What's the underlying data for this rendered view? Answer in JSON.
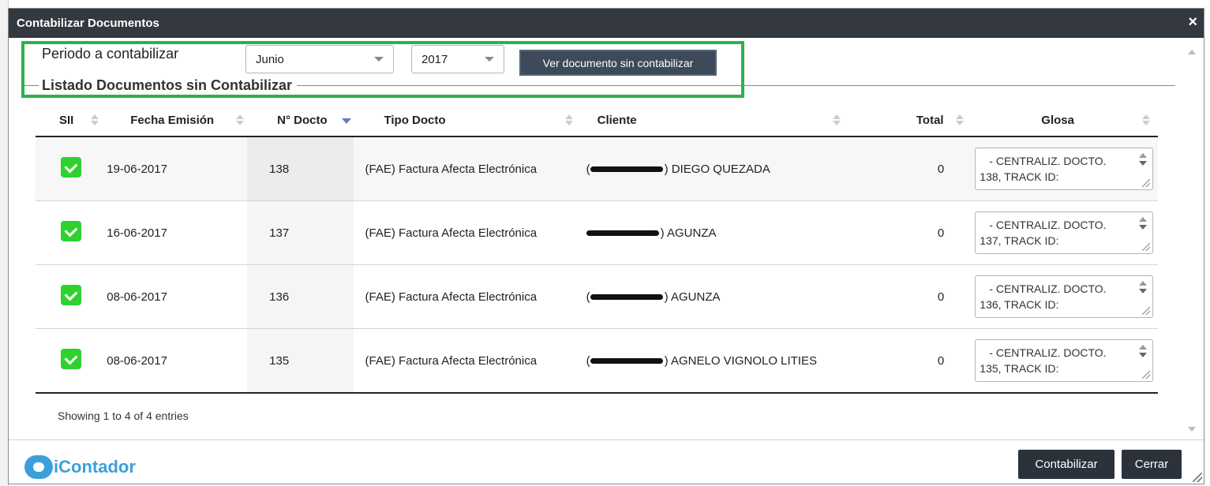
{
  "window": {
    "title": "Contabilizar Documentos",
    "close_icon": "×"
  },
  "filter": {
    "periodo_label": "Periodo a contabilizar",
    "month_value": "Junio",
    "year_value": "2017",
    "ver_button": "Ver documento sin contabilizar",
    "highlight_color": "#2db24a"
  },
  "listado": {
    "legend": "Listado Documentos sin Contabilizar"
  },
  "table": {
    "columns": [
      "SII",
      "Fecha Emisión",
      "N° Docto",
      "Tipo Docto",
      "Cliente",
      "Total",
      "Glosa"
    ],
    "rows": [
      {
        "sii": "checked",
        "fecha": "19-06-2017",
        "ndoc": "138",
        "tipo": "(FAE) Factura Afecta Electrónica",
        "cliente_prefix": "(",
        "cliente_name": ") DIEGO QUEZADA",
        "total": "0",
        "glosa": "- CENTRALIZ. DOCTO. 138, TRACK ID:"
      },
      {
        "sii": "checked",
        "fecha": "16-06-2017",
        "ndoc": "137",
        "tipo": "(FAE) Factura Afecta Electrónica",
        "cliente_prefix": "",
        "cliente_name": ") AGUNZA",
        "total": "0",
        "glosa": "- CENTRALIZ. DOCTO. 137, TRACK ID:"
      },
      {
        "sii": "checked",
        "fecha": "08-06-2017",
        "ndoc": "136",
        "tipo": "(FAE) Factura Afecta Electrónica",
        "cliente_prefix": "(",
        "cliente_name": ") AGUNZA",
        "total": "0",
        "glosa": "- CENTRALIZ. DOCTO. 136, TRACK ID:"
      },
      {
        "sii": "checked",
        "fecha": "08-06-2017",
        "ndoc": "135",
        "tipo": "(FAE) Factura Afecta Electrónica",
        "cliente_prefix": "(",
        "cliente_name": ") AGNELO VIGNOLO LITIES",
        "total": "0",
        "glosa": "- CENTRALIZ. DOCTO. 135, TRACK ID:"
      }
    ]
  },
  "footer": {
    "showing": "Showing 1 to 4 of 4 entries",
    "logo_text": "iContador",
    "contabilizar_button": "Contabilizar",
    "cerrar_button": "Cerrar",
    "accent": "#3aa0dc",
    "checkbox_color": "#2fd12f"
  }
}
